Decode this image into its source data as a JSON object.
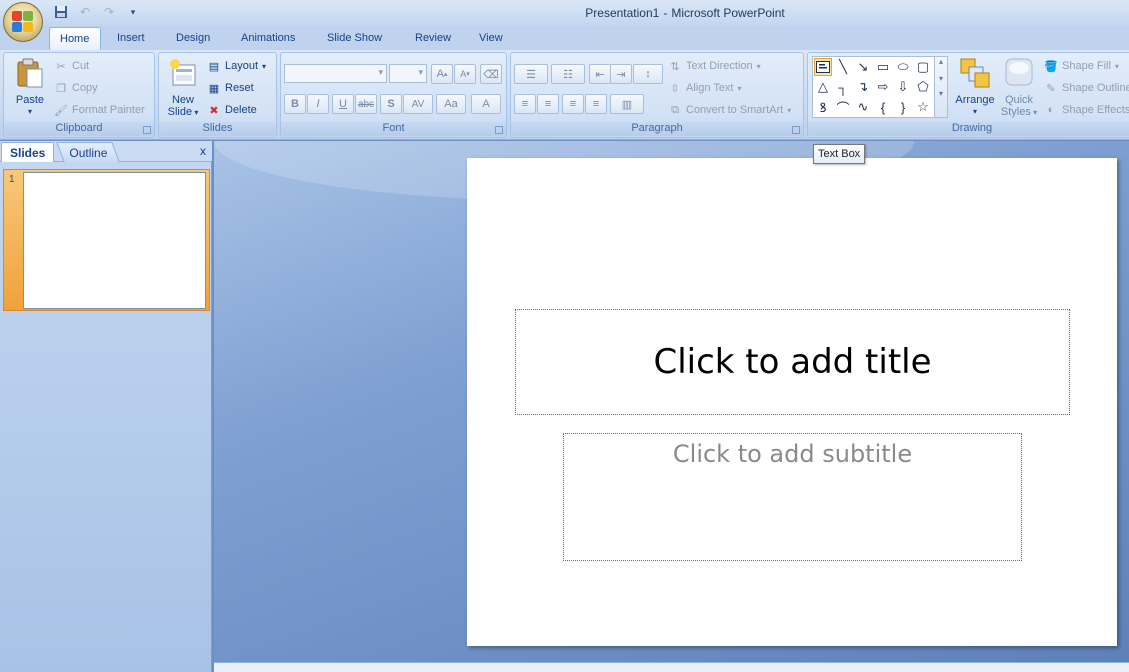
{
  "window": {
    "document": "Presentation1",
    "separator": "-",
    "app": "Microsoft PowerPoint"
  },
  "quick_access": {
    "icons": [
      "save-icon",
      "undo-icon",
      "redo-icon",
      "customize-icon"
    ]
  },
  "tabs": [
    "Home",
    "Insert",
    "Design",
    "Animations",
    "Slide Show",
    "Review",
    "View"
  ],
  "ribbon": {
    "clipboard": {
      "label": "Clipboard",
      "paste": "Paste",
      "cut": "Cut",
      "copy": "Copy",
      "format_painter": "Format Painter"
    },
    "slides": {
      "label": "Slides",
      "new_slide_1": "New",
      "new_slide_2": "Slide",
      "layout": "Layout",
      "reset": "Reset",
      "delete": "Delete"
    },
    "font": {
      "label": "Font",
      "bold": "B",
      "italic": "I",
      "underline": "U",
      "strike": "abc",
      "shadow": "S",
      "spacing": "AV",
      "case": "Aa",
      "grow": "A",
      "shrink": "A",
      "color": "A"
    },
    "paragraph": {
      "label": "Paragraph",
      "text_direction": "Text Direction",
      "align_text": "Align Text",
      "convert_smartart": "Convert to SmartArt"
    },
    "drawing": {
      "label": "Drawing",
      "arrange": "Arrange",
      "quick_1": "Quick",
      "quick_2": "Styles",
      "shape_fill": "Shape Fill",
      "shape_outline": "Shape Outline",
      "shape_effects": "Shape Effects"
    }
  },
  "pane": {
    "tab_slides": "Slides",
    "tab_outline": "Outline",
    "close": "x",
    "slide_number": "1"
  },
  "slide": {
    "title_placeholder": "Click to add title",
    "subtitle_placeholder": "Click to add subtitle"
  },
  "tooltip": "Text Box"
}
